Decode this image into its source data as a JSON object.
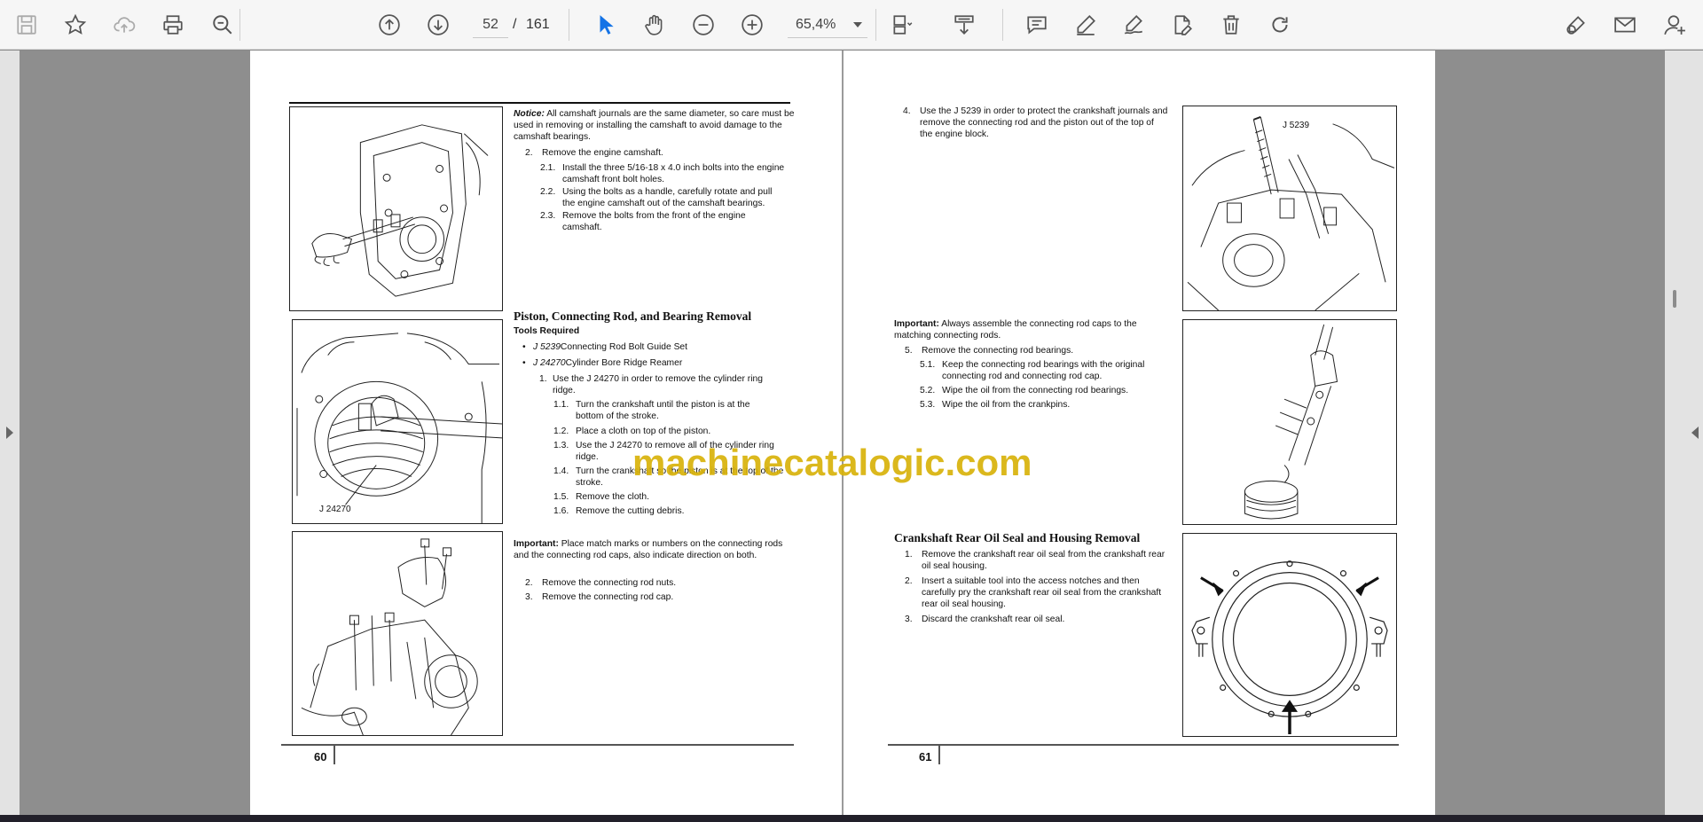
{
  "toolbar": {
    "current_page": "52",
    "page_separator": "/",
    "total_pages": "161",
    "zoom": "65,4%"
  },
  "left_page": {
    "notice_label": "Notice:",
    "notice_text": " All camshaft journals are the same diameter, so care must be used in removing or installing the camshaft to avoid damage to the camshaft bearings.",
    "steps_a": [
      {
        "num": "2.",
        "text": "Remove the engine camshaft."
      },
      {
        "num": "2.1.",
        "text": "Install the three 5/16-18 x 4.0 inch bolts into the engine camshaft front bolt holes."
      },
      {
        "num": "2.2.",
        "text": "Using the bolts as a handle, carefully rotate and pull the engine camshaft out of the camshaft bearings."
      },
      {
        "num": "2.3.",
        "text": "Remove the bolts from the front of the engine camshaft."
      }
    ],
    "section_title": "Piston, Connecting Rod, and Bearing Removal",
    "tools_label": "Tools Required",
    "tools": [
      {
        "code": "J 5239",
        "desc": " Connecting Rod Bolt Guide Set"
      },
      {
        "code": "J 24270",
        "desc": " Cylinder Bore Ridge Reamer"
      }
    ],
    "steps_b": [
      {
        "num": "1.",
        "text": "Use the J 24270 in order to remove the cylinder ring ridge."
      },
      {
        "num": "1.1.",
        "text": "Turn the crankshaft until the piston is at the bottom of the stroke."
      },
      {
        "num": "1.2.",
        "text": "Place a cloth on top of the piston."
      },
      {
        "num": "1.3.",
        "text": "Use the J 24270 to remove all of the cylinder ring ridge."
      },
      {
        "num": "1.4.",
        "text": "Turn the crankshaft so the piston is at the top of the stroke."
      },
      {
        "num": "1.5.",
        "text": "Remove the cloth."
      },
      {
        "num": "1.6.",
        "text": "Remove the cutting debris."
      }
    ],
    "important_label": "Important:",
    "important_text": " Place match marks or numbers on the connecting rods and the connecting rod caps, also indicate direction on both.",
    "steps_c": [
      {
        "num": "2.",
        "text": "Remove the connecting rod nuts."
      },
      {
        "num": "3.",
        "text": "Remove the connecting rod cap."
      }
    ],
    "fig2_label": "J 24270",
    "page_number": "60"
  },
  "right_page": {
    "step4_num": "4.",
    "step4_text": "Use the J 5239 in order to protect the crankshaft journals and remove the connecting rod and the piston out of the top of the engine block.",
    "fig1_label": "J 5239",
    "important_label": "Important:",
    "important_text": " Always assemble the connecting rod caps to the matching connecting rods.",
    "steps_a": [
      {
        "num": "5.",
        "text": "Remove the connecting rod bearings."
      },
      {
        "num": "5.1.",
        "text": "Keep the connecting rod bearings with the original connecting rod and connecting rod cap."
      },
      {
        "num": "5.2.",
        "text": "Wipe the oil from the connecting rod bearings."
      },
      {
        "num": "5.3.",
        "text": "Wipe the oil from the crankpins."
      }
    ],
    "section_title": "Crankshaft Rear Oil Seal and Housing Removal",
    "steps_b": [
      {
        "num": "1.",
        "text": "Remove the crankshaft rear oil seal from the crankshaft rear oil seal housing."
      },
      {
        "num": "2.",
        "text": "Insert a suitable tool into the access notches and then carefully pry the crankshaft rear oil seal from the crankshaft rear oil seal housing."
      },
      {
        "num": "3.",
        "text": "Discard the crankshaft rear oil seal."
      }
    ],
    "page_number": "61"
  },
  "watermark": "machinecatalogic.com",
  "icons": [
    "save-icon",
    "star-icon",
    "cloud-upload-icon",
    "print-icon",
    "zoom-search-icon",
    "page-up-icon",
    "page-down-icon",
    "select-cursor-icon",
    "hand-icon",
    "zoom-out-icon",
    "zoom-in-icon",
    "fit-page-icon",
    "scroll-mode-icon",
    "comment-icon",
    "highlight-pen-icon",
    "sign-icon",
    "edit-file-icon",
    "delete-icon",
    "redo-icon",
    "share-link-icon",
    "email-icon",
    "add-user-icon"
  ],
  "colors": {
    "accent": "#1473e6",
    "watermark": "#d8b20a"
  }
}
